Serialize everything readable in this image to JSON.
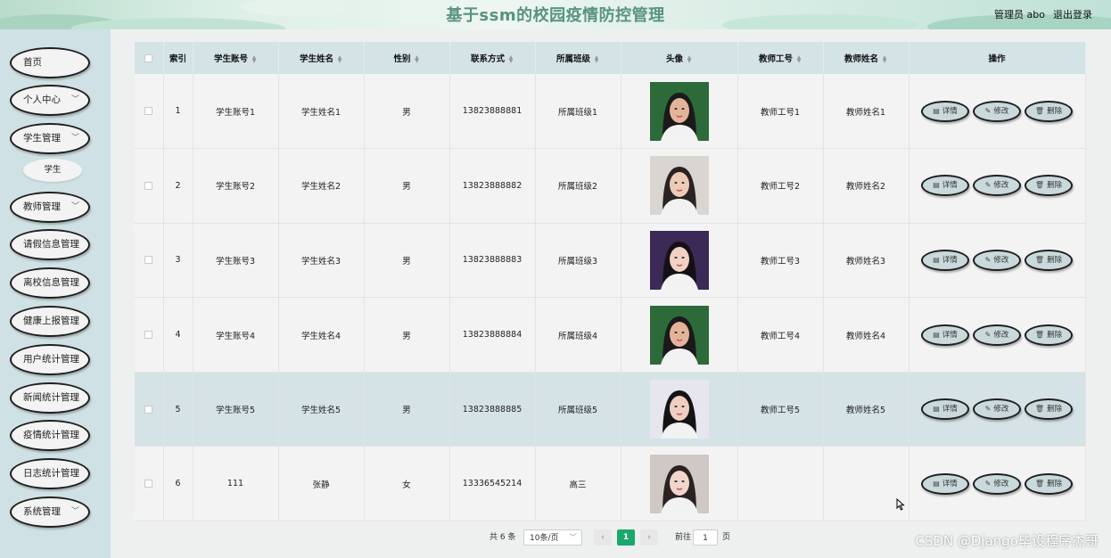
{
  "header": {
    "title": "基于ssm的校园疫情防控管理",
    "user": "管理员 abo",
    "logout": "退出登录"
  },
  "sidebar": {
    "items": [
      {
        "label": "首页",
        "chevron": false
      },
      {
        "label": "个人中心",
        "chevron": true
      },
      {
        "label": "学生管理",
        "chevron": true
      },
      {
        "label": "教师管理",
        "chevron": true
      },
      {
        "label": "请假信息管理",
        "chevron": false
      },
      {
        "label": "离校信息管理",
        "chevron": false
      },
      {
        "label": "健康上报管理",
        "chevron": false
      },
      {
        "label": "用户统计管理",
        "chevron": false
      },
      {
        "label": "新闻统计管理",
        "chevron": false
      },
      {
        "label": "疫情统计管理",
        "chevron": false
      },
      {
        "label": "日志统计管理",
        "chevron": false
      },
      {
        "label": "系统管理",
        "chevron": true
      }
    ],
    "submenu": {
      "label": "学生"
    }
  },
  "table": {
    "headers": [
      "索引",
      "学生账号",
      "学生姓名",
      "性别",
      "联系方式",
      "所属班级",
      "头像",
      "教师工号",
      "教师姓名",
      "操作"
    ],
    "rows": [
      {
        "index": "1",
        "account": "学生账号1",
        "name": "学生姓名1",
        "gender": "男",
        "phone": "13823888881",
        "class": "所属班级1",
        "teacher_id": "教师工号1",
        "teacher_name": "教师姓名1"
      },
      {
        "index": "2",
        "account": "学生账号2",
        "name": "学生姓名2",
        "gender": "男",
        "phone": "13823888882",
        "class": "所属班级2",
        "teacher_id": "教师工号2",
        "teacher_name": "教师姓名2"
      },
      {
        "index": "3",
        "account": "学生账号3",
        "name": "学生姓名3",
        "gender": "男",
        "phone": "13823888883",
        "class": "所属班级3",
        "teacher_id": "教师工号3",
        "teacher_name": "教师姓名3"
      },
      {
        "index": "4",
        "account": "学生账号4",
        "name": "学生姓名4",
        "gender": "男",
        "phone": "13823888884",
        "class": "所属班级4",
        "teacher_id": "教师工号4",
        "teacher_name": "教师姓名4"
      },
      {
        "index": "5",
        "account": "学生账号5",
        "name": "学生姓名5",
        "gender": "男",
        "phone": "13823888885",
        "class": "所属班级5",
        "teacher_id": "教师工号5",
        "teacher_name": "教师姓名5"
      },
      {
        "index": "6",
        "account": "111",
        "name": "张静",
        "gender": "女",
        "phone": "13336545214",
        "class": "高三",
        "teacher_id": "",
        "teacher_name": ""
      }
    ],
    "actions": {
      "detail": "详情",
      "edit": "修改",
      "delete": "删除"
    }
  },
  "pagination": {
    "total": "共 6 条",
    "page_size": "10条/页",
    "current": "1",
    "goto_prefix": "前往",
    "goto_value": "1",
    "goto_suffix": "页"
  },
  "watermark": "CSDN @Django毕设程序杰哥",
  "colors": {
    "accent": "#1aa86b",
    "header_row": "#d3e3e6",
    "sidebar_bg": "#cfe1e4"
  }
}
